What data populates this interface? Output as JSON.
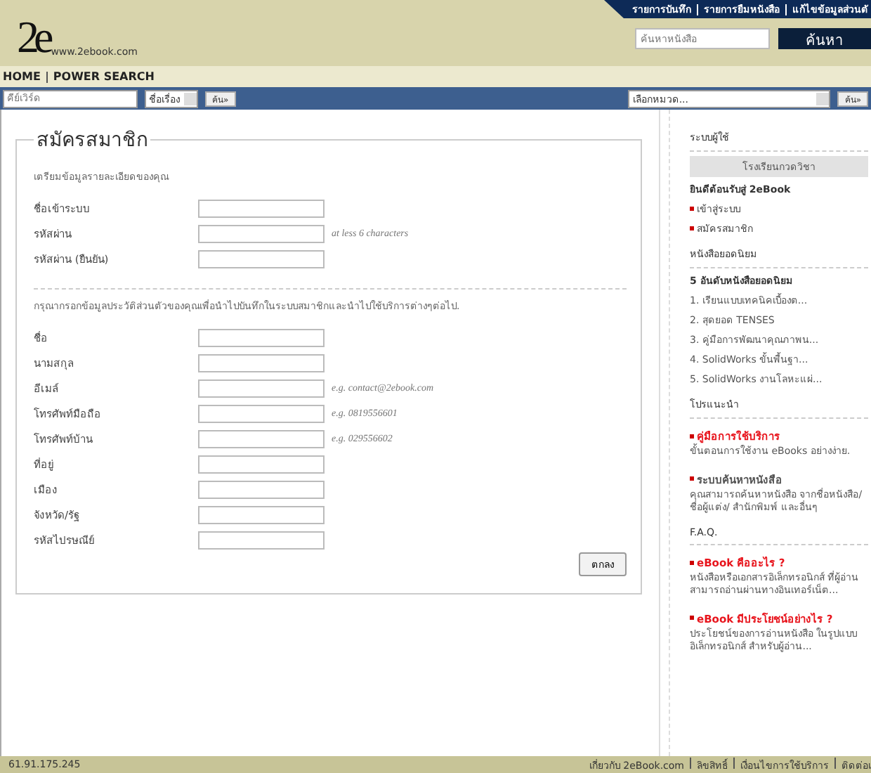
{
  "header": {
    "logo_text": "2e",
    "logo_url": "www.2ebook.com",
    "top_links": [
      "รายการบันทึก",
      "รายการยืมหนังสือ",
      "แก้ไขข้อมูลส่วนตั"
    ],
    "search": {
      "placeholder": "ค้นหาหนังสือ",
      "button": "ค้นหา"
    }
  },
  "nav": [
    "HOME",
    "POWER SEARCH"
  ],
  "search_bar": {
    "keyword_placeholder": "คีย์เวิร์ด",
    "field_select": "ชื่อเรื่อง",
    "button": "ค้น»",
    "category_select": "เลือกหมวด...",
    "category_button": "ค้น»"
  },
  "form": {
    "title": "สมัครสมาชิก",
    "sections": [
      {
        "intro": "เตรียมข้อมูลรายละเอียดของคุณ",
        "fields": [
          {
            "label": "ชื่อเข้าระบบ"
          },
          {
            "label": "รหัสผ่าน",
            "hint": "at less 6 characters"
          },
          {
            "label": "รหัสผ่าน (ยืนยัน)"
          }
        ]
      },
      {
        "intro": "กรุณากรอกข้อมูลประวัติส่วนตัวของคุณเพื่อนำไปบันทึกในระบบสมาชิกและนำไปใช้บริการต่างๆต่อไป.",
        "fields": [
          {
            "label": "ชื่อ"
          },
          {
            "label": "นามสกุล"
          },
          {
            "label": "อีเมล์",
            "hint": "e.g. contact@2ebook.com"
          },
          {
            "label": "โทรศัพท์มือถือ",
            "hint": "e.g. 0819556601"
          },
          {
            "label": "โทรศัพท์บ้าน",
            "hint": "e.g. 029556602"
          },
          {
            "label": "ที่อยู่"
          },
          {
            "label": "เมือง"
          },
          {
            "label": "จังหวัด/รัฐ"
          },
          {
            "label": "รหัสไปรษณีย์"
          }
        ]
      }
    ],
    "submit": "ตกลง"
  },
  "sidebar": {
    "user": {
      "title": "ระบบผู้ใช้",
      "banner": "โรงเรียนกวดวิชา",
      "welcome": "ยินดีต้อนรับสู่ 2eBook",
      "links": [
        "เข้าสู่ระบบ",
        "สมัครสมาชิก"
      ]
    },
    "popular": {
      "title": "หนังสือยอดนิยม",
      "subtitle": "5 อันดับหนังสือยอดนิยม",
      "books": [
        "1. เรียนแบบเทคนิคเบื้องต...",
        "2. สุดยอด TENSES",
        "3. คู่มือการพัฒนาคุณภาพน...",
        "4. SolidWorks ขั้นพื้นฐา...",
        "5. SolidWorks งานโลหะแผ่..."
      ]
    },
    "promo": {
      "title": "โปรแนะนำ",
      "items": [
        {
          "title": "คู่มือการใช้บริการ",
          "color": "#e8141c",
          "text": "ขั้นตอนการใช้งาน eBooks อย่างง่าย."
        },
        {
          "title": "ระบบค้นหาหนังสือ",
          "color": "#555555",
          "text": "คุณสามารถค้นหาหนังสือ จากชื่อหนังสือ/ ชื่อผู้แต่ง/ สำนักพิมพ์ และอื่นๆ"
        }
      ]
    },
    "faq": {
      "title": "F.A.Q.",
      "items": [
        {
          "title": "eBook คืออะไร ?",
          "color": "#e8141c",
          "text": "หนังสือหรือเอกสารอิเล็กทรอนิกส์ ที่ผู้อ่านสามารถอ่านผ่านทางอินเทอร์เน็ต..."
        },
        {
          "title": "eBook มีประโยชน์อย่างไร ?",
          "color": "#e8141c",
          "text": "ประโยชน์ของการอ่านหนังสือ ในรูปแบบอิเล็กทรอนิกส์ สำหรับผู้อ่าน..."
        }
      ]
    }
  },
  "footer": {
    "ip": "61.91.175.245",
    "links": [
      "เกี่ยวกับ 2eBook.com",
      "ลิขสิทธิ์",
      "เงื่อนไขการใช้บริการ",
      "ติดต่อเ"
    ]
  }
}
